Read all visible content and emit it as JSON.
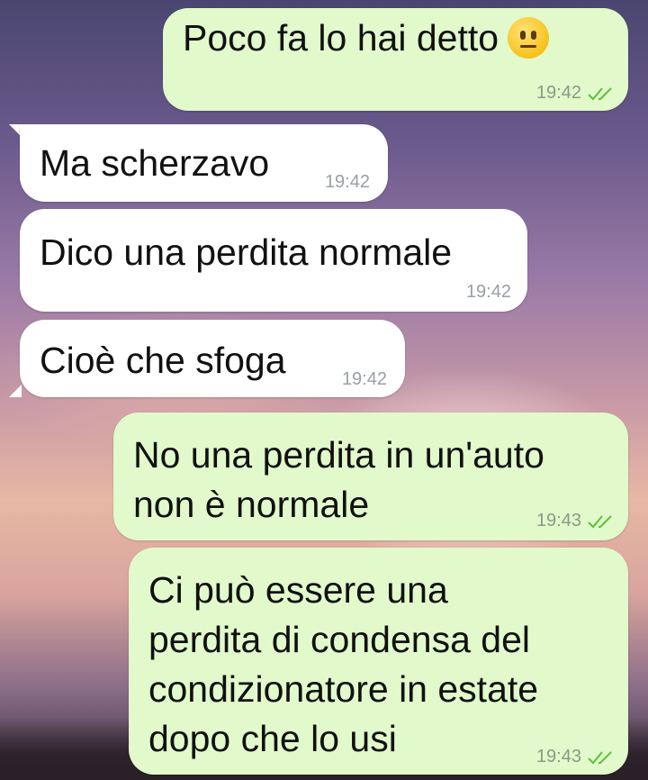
{
  "colors": {
    "outgoing_bubble": "#e1f9cb",
    "incoming_bubble": "#ffffff",
    "read_ticks": "#5fbf3a"
  },
  "messages": [
    {
      "direction": "outgoing",
      "text": "Poco fa lo hai detto",
      "emoji": "neutral-face-emoji",
      "time": "19:42",
      "status": "read"
    },
    {
      "direction": "incoming",
      "text": "Ma scherzavo",
      "time": "19:42"
    },
    {
      "direction": "incoming",
      "text": "Dico una perdita normale",
      "time": "19:42"
    },
    {
      "direction": "incoming",
      "text": "Cioè che sfoga",
      "time": "19:42"
    },
    {
      "direction": "outgoing",
      "lines": [
        "No una perdita in un'auto",
        "non è normale"
      ],
      "time": "19:43",
      "status": "read"
    },
    {
      "direction": "outgoing",
      "lines": [
        "Ci può essere una",
        "perdita di condensa del",
        "condizionatore in estate",
        "dopo che lo usi"
      ],
      "time": "19:43",
      "status": "read"
    }
  ]
}
